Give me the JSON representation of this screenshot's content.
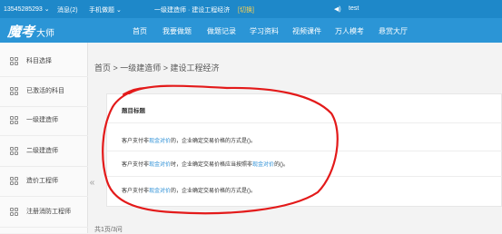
{
  "topbar": {
    "phone": "13545285293 ⌄",
    "messages": "消息(2)",
    "mobile_tiku": "手机做题 ⌄",
    "current_exam": "一级建造师 · 建设工程经济",
    "switch": "[切换]",
    "audio": "test"
  },
  "header": {
    "logo_mark": "魔考",
    "logo_text": "大师",
    "nav": [
      "首页",
      "我要做题",
      "做题记录",
      "学习资料",
      "视频课件",
      "万人模考",
      "悬赏大厅"
    ]
  },
  "sidebar": {
    "items": [
      {
        "label": "科目选择"
      },
      {
        "label": "已激活的科目"
      },
      {
        "label": "一级建造师"
      },
      {
        "label": "二级建造师"
      },
      {
        "label": "造价工程师"
      },
      {
        "label": "注册消防工程师"
      }
    ],
    "collapse_glyph": "«"
  },
  "breadcrumb": "首页 > 一级建造师 > 建设工程经济",
  "card": {
    "title": "题目标题",
    "questions": [
      {
        "pre": "客户支付非",
        "link": "现金对价",
        "post": "的，企业确定交易价格的方式是()。",
        "link2": "",
        "post2": ""
      },
      {
        "pre": "客户支付非",
        "link": "现金对价",
        "post": "时，企业确定交易价格应当按照非",
        "link2": "现金对价",
        "post2": "的()。"
      },
      {
        "pre": "客户支付非",
        "link": "现金对价",
        "post": "的，企业确定交易价格的方式是()。",
        "link2": "",
        "post2": ""
      }
    ]
  },
  "pager": "共1页/3问",
  "colors": {
    "topbar": "#1e88c9",
    "nav": "#2b95d6",
    "link": "#2b8fd6",
    "annotation": "#e31a1a"
  }
}
